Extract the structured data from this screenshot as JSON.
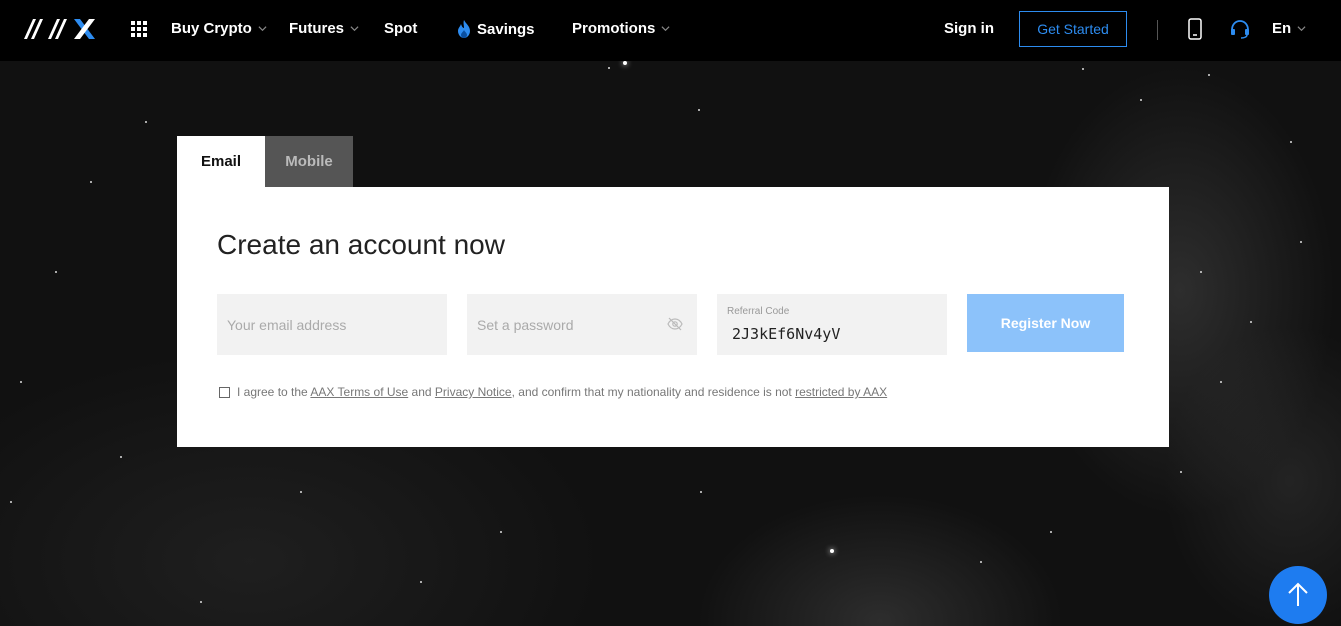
{
  "nav": {
    "logo_text": "AAX",
    "items": [
      {
        "label": "Buy Crypto",
        "has_dropdown": true
      },
      {
        "label": "Futures",
        "has_dropdown": true
      },
      {
        "label": "Spot",
        "has_dropdown": false
      },
      {
        "label": "Savings",
        "has_dropdown": false,
        "icon": "flame-icon"
      },
      {
        "label": "Promotions",
        "has_dropdown": true
      }
    ],
    "sign_in": "Sign in",
    "get_started": "Get Started",
    "language": "En"
  },
  "tabs": [
    {
      "label": "Email",
      "active": true
    },
    {
      "label": "Mobile",
      "active": false
    }
  ],
  "form": {
    "title": "Create an account now",
    "email_placeholder": "Your email address",
    "password_placeholder": "Set a password",
    "referral_label": "Referral Code",
    "referral_value": "2J3kEf6Nv4yV",
    "register_label": "Register Now",
    "agreement": {
      "prefix": "I agree to the",
      "terms_link": "AAX Terms of Use",
      "and": "and",
      "privacy_link": "Privacy Notice",
      "middle": ", and confirm that my nationality and residence is not",
      "restricted_link": "restricted by AAX"
    }
  },
  "colors": {
    "accent": "#2d8cf0",
    "register_button": "#8cc2fa",
    "scroll_top_button": "#1e7cf0"
  }
}
